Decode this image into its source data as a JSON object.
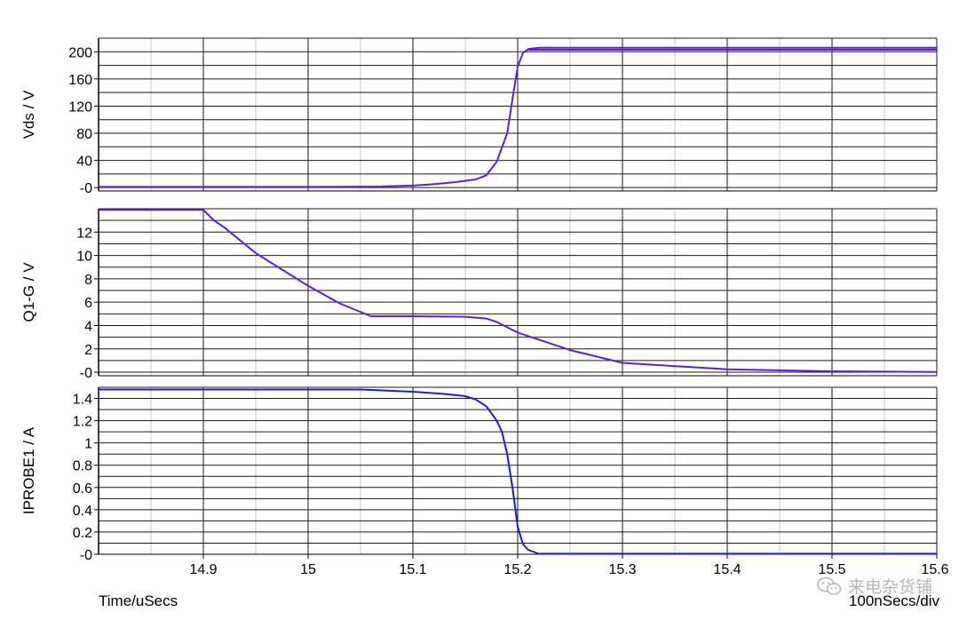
{
  "chart_data": [
    {
      "type": "line",
      "ylabel": "Vds / V",
      "ylim": [
        -5,
        220
      ],
      "yticks": [
        0,
        40,
        80,
        120,
        160,
        200
      ],
      "ytick_labels": [
        "-0",
        "40",
        "80",
        "120",
        "160",
        "200"
      ],
      "ygrid": [
        0,
        20,
        40,
        60,
        80,
        100,
        120,
        140,
        160,
        180,
        200,
        220
      ],
      "series": [
        {
          "color": "#5a20d8",
          "x": [
            14.8,
            15.0,
            15.07,
            15.1,
            15.12,
            15.14,
            15.16,
            15.17,
            15.18,
            15.19,
            15.195,
            15.2,
            15.205,
            15.21,
            15.22,
            15.3,
            15.6
          ],
          "y": [
            1,
            1,
            1.5,
            3,
            5,
            8,
            12,
            18,
            38,
            80,
            130,
            178,
            198,
            204,
            206,
            206,
            206
          ]
        },
        {
          "color": "#5a20d8",
          "x": [
            15.21,
            15.6
          ],
          "y": [
            203,
            203
          ]
        }
      ]
    },
    {
      "type": "line",
      "ylabel": "Q1-G / V",
      "ylim": [
        -0.3,
        14
      ],
      "yticks": [
        0,
        2,
        4,
        6,
        8,
        10,
        12
      ],
      "ytick_labels": [
        "-0",
        "2",
        "4",
        "6",
        "8",
        "10",
        "12"
      ],
      "ygrid": [
        0,
        1,
        2,
        3,
        4,
        5,
        6,
        7,
        8,
        9,
        10,
        11,
        12,
        13,
        14
      ],
      "series": [
        {
          "color": "#5a20d8",
          "x": [
            14.8,
            14.9,
            14.91,
            14.92,
            14.95,
            15.0,
            15.03,
            15.06,
            15.1,
            15.15,
            15.17,
            15.18,
            15.2,
            15.25,
            15.3,
            15.4,
            15.5,
            15.6
          ],
          "y": [
            13.9,
            13.9,
            13.0,
            12.4,
            10.2,
            7.4,
            5.9,
            4.8,
            4.8,
            4.75,
            4.6,
            4.3,
            3.4,
            1.9,
            0.8,
            0.25,
            0.08,
            0.02
          ]
        }
      ]
    },
    {
      "type": "line",
      "ylabel": "IPROBE1 / A",
      "ylim": [
        0,
        1.5
      ],
      "yticks": [
        0,
        0.2,
        0.4,
        0.6,
        0.8,
        1,
        1.2,
        1.4
      ],
      "ytick_labels": [
        "-0",
        "0.2",
        "0.4",
        "0.6",
        "0.8",
        "1",
        "1.2",
        "1.4"
      ],
      "ygrid": [
        0,
        0.1,
        0.2,
        0.3,
        0.4,
        0.5,
        0.6,
        0.7,
        0.8,
        0.9,
        1.0,
        1.1,
        1.2,
        1.3,
        1.4,
        1.5
      ],
      "series": [
        {
          "color": "#1a1ae0",
          "x": [
            14.8,
            15.05,
            15.1,
            15.13,
            15.15,
            15.16,
            15.17,
            15.18,
            15.185,
            15.19,
            15.195,
            15.2,
            15.205,
            15.21,
            15.22,
            15.6
          ],
          "y": [
            1.48,
            1.48,
            1.46,
            1.44,
            1.42,
            1.39,
            1.33,
            1.2,
            1.1,
            0.9,
            0.6,
            0.25,
            0.09,
            0.04,
            0.005,
            0.005
          ]
        }
      ]
    }
  ],
  "x_axis": {
    "xlim": [
      14.8,
      15.6
    ],
    "ticks": [
      14.9,
      15.0,
      15.1,
      15.2,
      15.3,
      15.4,
      15.5,
      15.6
    ],
    "tick_labels": [
      "14.9",
      "15",
      "15.1",
      "15.2",
      "15.3",
      "15.4",
      "15.5",
      "15.6"
    ],
    "label": "Time/uSecs",
    "div_label": "100nSecs/div"
  },
  "watermark": {
    "text": "来电杂货铺",
    "icon": "wechat-icon"
  }
}
